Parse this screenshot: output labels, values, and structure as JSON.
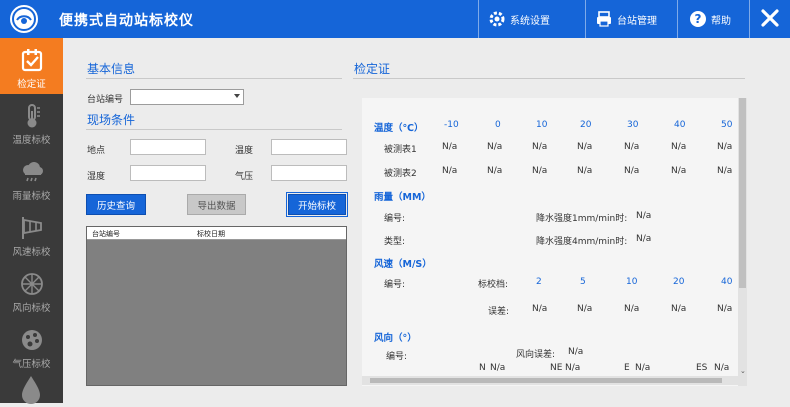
{
  "app": {
    "title": "便携式自动站标校仪"
  },
  "header": {
    "system_settings": "系统设置",
    "station_management": "台站管理",
    "help": "帮助"
  },
  "sidebar": {
    "items": [
      {
        "label": "检定证",
        "icon": "certificate-icon",
        "active": true
      },
      {
        "label": "温度标校",
        "icon": "thermometer-icon"
      },
      {
        "label": "雨量标校",
        "icon": "rain-cloud-icon"
      },
      {
        "label": "风速标校",
        "icon": "wind-sock-icon"
      },
      {
        "label": "风向标校",
        "icon": "wind-direction-icon"
      },
      {
        "label": "气压标校",
        "icon": "pressure-gauge-icon"
      }
    ]
  },
  "basic_info": {
    "title": "基本信息",
    "station_id_label": "台站编号",
    "station_id_value": ""
  },
  "site_conditions": {
    "title": "现场条件",
    "location_label": "地点",
    "temperature_label": "温度",
    "humidity_label": "湿度",
    "pressure_label": "气压"
  },
  "actions": {
    "history": "历史查询",
    "export": "导出数据",
    "start": "开始标校"
  },
  "history_table": {
    "columns": [
      "台站编号",
      "标校日期"
    ]
  },
  "certificate": {
    "title": "检定证",
    "temperature": {
      "title": "温度（℃）",
      "points": [
        "-10",
        "0",
        "10",
        "20",
        "30",
        "40",
        "50"
      ],
      "rows": [
        {
          "label": "被测表1",
          "values": [
            "N/a",
            "N/a",
            "N/a",
            "N/a",
            "N/a",
            "N/a",
            "N/a"
          ]
        },
        {
          "label": "被测表2",
          "values": [
            "N/a",
            "N/a",
            "N/a",
            "N/a",
            "N/a",
            "N/a",
            "N/a"
          ]
        }
      ]
    },
    "rain": {
      "title": "雨量（MM）",
      "id_label": "编号:",
      "type_label": "类型:",
      "intensity1_label": "降水强度1mm/min时:",
      "intensity1_value": "N/a",
      "intensity2_label": "降水强度4mm/min时:",
      "intensity2_value": "N/a"
    },
    "wind_speed": {
      "title": "风速（M/S）",
      "id_label": "编号:",
      "gear_label": "标校档:",
      "gears": [
        "2",
        "5",
        "10",
        "20",
        "40"
      ],
      "error_label": "误差:",
      "errors": [
        "N/a",
        "N/a",
        "N/a",
        "N/a",
        "N/a"
      ]
    },
    "wind_direction": {
      "title": "风向（°）",
      "id_label": "编号:",
      "error_label": "风向误差:",
      "error_value": "N/a",
      "dirs": [
        {
          "label": "N",
          "value": "N/a"
        },
        {
          "label": "NE",
          "value": "N/a"
        },
        {
          "label": "E",
          "value": "N/a"
        },
        {
          "label": "ES",
          "value": "N/a"
        }
      ]
    }
  }
}
